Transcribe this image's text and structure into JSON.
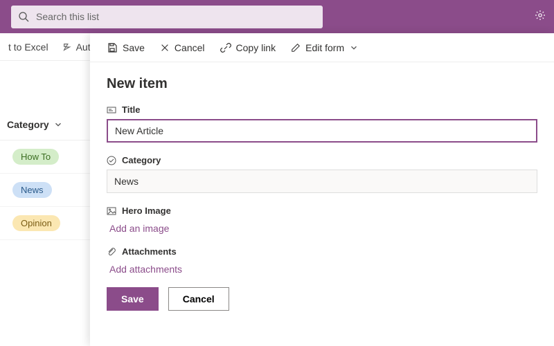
{
  "topbar": {
    "search_placeholder": "Search this list"
  },
  "bgcmd": {
    "export": "t to Excel",
    "auto": "Auto"
  },
  "column": {
    "header": "Category",
    "pills": [
      "How To",
      "News",
      "Opinion"
    ]
  },
  "panel": {
    "title": "New item",
    "cmdbar": {
      "save": "Save",
      "cancel": "Cancel",
      "copy": "Copy link",
      "edit": "Edit form"
    },
    "fields": {
      "title_label": "Title",
      "title_value": "New Article",
      "category_label": "Category",
      "category_value": "News",
      "hero_label": "Hero Image",
      "hero_action": "Add an image",
      "attach_label": "Attachments",
      "attach_action": "Add attachments"
    },
    "footer": {
      "save": "Save",
      "cancel": "Cancel"
    }
  }
}
